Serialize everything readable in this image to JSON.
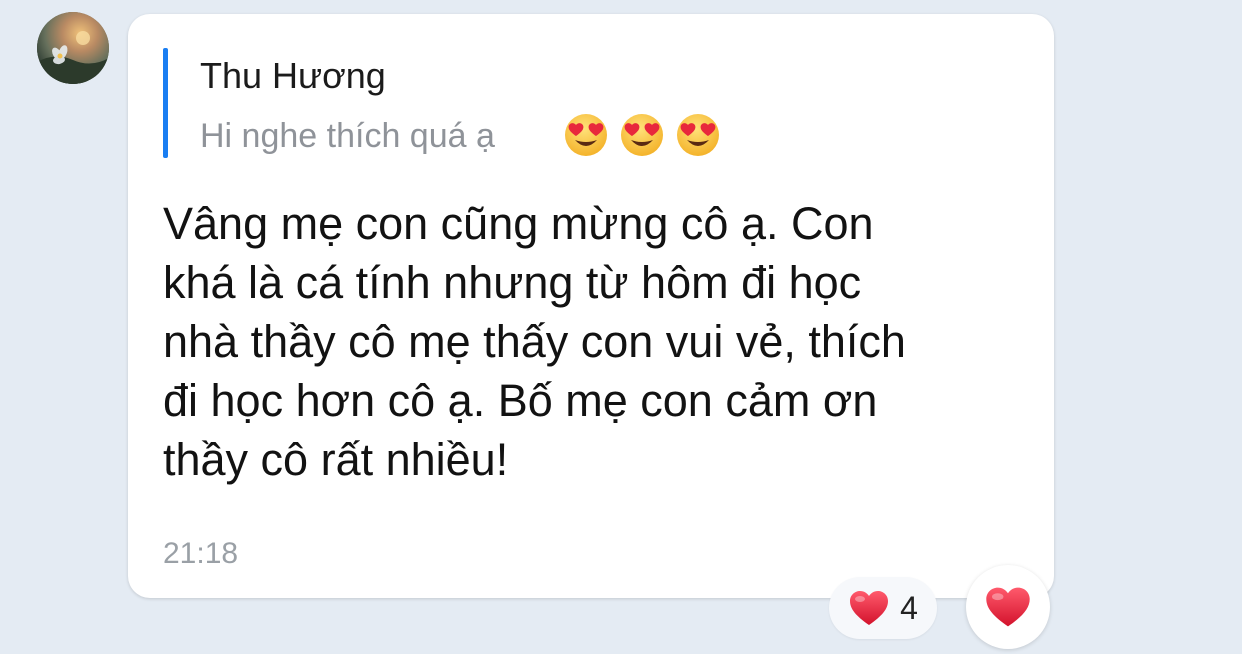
{
  "sender_avatar": "sunset-avatar",
  "quote": {
    "author": "Thu Hương",
    "text": "Hi nghe thích quá ạ",
    "emoji_icon": "heart-eyes-emoji",
    "emoji_count": 3,
    "bar_color": "#1a7ef2"
  },
  "message": {
    "lines": [
      "Vâng mẹ con cũng mừng cô ạ. Con",
      "khá là cá tính nhưng từ hôm đi học",
      "nhà thầy cô mẹ thấy con vui vẻ, thích",
      "đi học hơn cô ạ. Bố mẹ con cảm ơn",
      "thầy cô rất nhiều!"
    ],
    "time": "21:18"
  },
  "reactions": {
    "icon": "heart-icon",
    "count": "4",
    "react_button_icon": "heart-icon"
  }
}
